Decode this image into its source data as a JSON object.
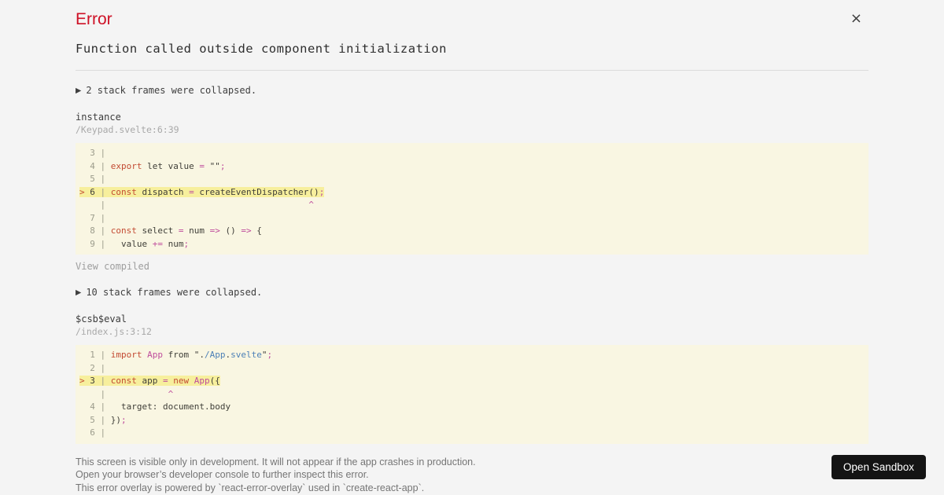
{
  "colors": {
    "page_background": "#f4f4f4",
    "error_red": "#ce1126",
    "code_background": "#f9f6e2",
    "code_highlight": "#f7ef9d",
    "keyword": "#c34b33",
    "operator": "#bf4d9c",
    "module_path_blue": "#4d80b7",
    "button_background": "#141414"
  },
  "header": {
    "title": "Error",
    "close_icon": "×"
  },
  "error": {
    "message": "Function called outside component initialization"
  },
  "frames": [
    {
      "collapse": {
        "icon": "▶",
        "text": "2 stack frames were collapsed."
      },
      "function_name": "instance",
      "location": "/Keypad.svelte:6:39",
      "view_link": "View compiled",
      "code_lines": [
        {
          "highlight": false,
          "tokens": [
            [
              "g",
              "  3 | "
            ]
          ]
        },
        {
          "highlight": false,
          "tokens": [
            [
              "g",
              "  4 | "
            ],
            [
              "k",
              "export"
            ],
            [
              "d",
              " let value "
            ],
            [
              "m",
              "="
            ],
            [
              "d",
              " \"\""
            ],
            [
              "m",
              ";"
            ]
          ]
        },
        {
          "highlight": false,
          "tokens": [
            [
              "g",
              "  5 | "
            ]
          ]
        },
        {
          "highlight": true,
          "tokens": [
            [
              "k",
              "> "
            ],
            [
              "d",
              "6"
            ],
            [
              "g",
              " | "
            ],
            [
              "k",
              "const"
            ],
            [
              "d",
              " dispatch "
            ],
            [
              "m",
              "="
            ],
            [
              "d",
              " createEventDispatcher()"
            ],
            [
              "m",
              ";"
            ]
          ]
        },
        {
          "highlight": false,
          "tokens": [
            [
              "g",
              "    | "
            ],
            [
              "d",
              "                                      "
            ],
            [
              "m",
              "^"
            ]
          ]
        },
        {
          "highlight": false,
          "tokens": [
            [
              "g",
              "  7 | "
            ]
          ]
        },
        {
          "highlight": false,
          "tokens": [
            [
              "g",
              "  8 | "
            ],
            [
              "k",
              "const"
            ],
            [
              "d",
              " select "
            ],
            [
              "m",
              "="
            ],
            [
              "d",
              " num "
            ],
            [
              "m",
              "=>"
            ],
            [
              "d",
              " () "
            ],
            [
              "m",
              "=>"
            ],
            [
              "d",
              " {"
            ]
          ]
        },
        {
          "highlight": false,
          "tokens": [
            [
              "g",
              "  9 | "
            ],
            [
              "d",
              "  value "
            ],
            [
              "m",
              "+="
            ],
            [
              "d",
              " num"
            ],
            [
              "m",
              ";"
            ]
          ]
        }
      ]
    },
    {
      "collapse": {
        "icon": "▶",
        "text": "10 stack frames were collapsed."
      },
      "function_name": "$csb$eval",
      "location": "/index.js:3:12",
      "view_link": "",
      "code_lines": [
        {
          "highlight": false,
          "tokens": [
            [
              "g",
              "  1 | "
            ],
            [
              "k",
              "import"
            ],
            [
              "d",
              " "
            ],
            [
              "m",
              "App"
            ],
            [
              "d",
              " from \"."
            ],
            [
              "b",
              "/App"
            ],
            [
              "d",
              "."
            ],
            [
              "b",
              "svelte"
            ],
            [
              "d",
              "\""
            ],
            [
              "m",
              ";"
            ]
          ]
        },
        {
          "highlight": false,
          "tokens": [
            [
              "g",
              "  2 | "
            ]
          ]
        },
        {
          "highlight": true,
          "tokens": [
            [
              "k",
              "> "
            ],
            [
              "d",
              "3"
            ],
            [
              "g",
              " | "
            ],
            [
              "k",
              "const"
            ],
            [
              "d",
              " app "
            ],
            [
              "m",
              "="
            ],
            [
              "d",
              " "
            ],
            [
              "k",
              "new"
            ],
            [
              "d",
              " "
            ],
            [
              "m",
              "App"
            ],
            [
              "d",
              "({"
            ]
          ]
        },
        {
          "highlight": false,
          "tokens": [
            [
              "g",
              "    | "
            ],
            [
              "d",
              "           "
            ],
            [
              "m",
              "^"
            ]
          ]
        },
        {
          "highlight": false,
          "tokens": [
            [
              "g",
              "  4 | "
            ],
            [
              "d",
              "  target: document.body"
            ]
          ]
        },
        {
          "highlight": false,
          "tokens": [
            [
              "g",
              "  5 | "
            ],
            [
              "d",
              "})"
            ],
            [
              "m",
              ";"
            ]
          ]
        },
        {
          "highlight": false,
          "tokens": [
            [
              "g",
              "  6 | "
            ]
          ]
        }
      ]
    }
  ],
  "footer": {
    "lines": [
      "This screen is visible only in development. It will not appear if the app crashes in production.",
      "Open your browser’s developer console to further inspect this error.",
      "This error overlay is powered by `react-error-overlay` used in `create-react-app`."
    ]
  },
  "sandbox_button": {
    "label": "Open Sandbox"
  }
}
